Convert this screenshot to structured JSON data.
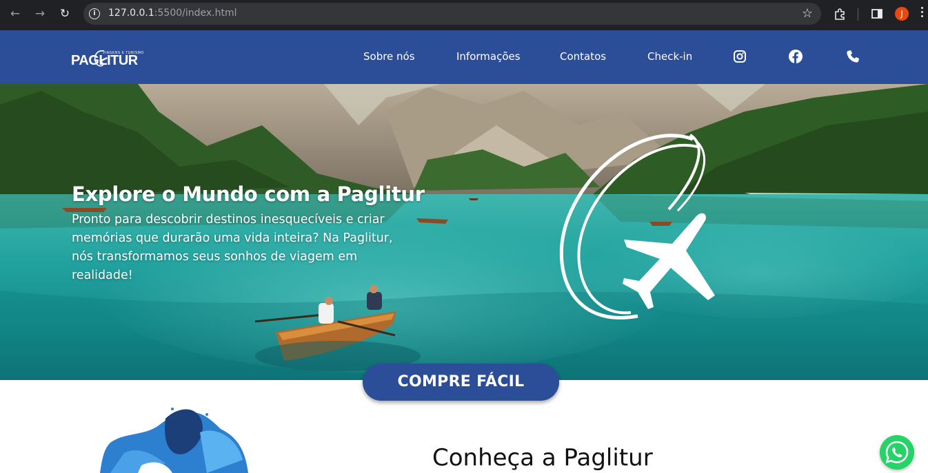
{
  "browser": {
    "url_host": "127.0.0.1",
    "url_rest": ":5500/index.html",
    "profile_initial": "J"
  },
  "header": {
    "logo_text": "PAGLITUR",
    "logo_tagline": "VIAGENS E TURISMO",
    "menu": [
      {
        "label": "Sobre nós"
      },
      {
        "label": "Informações"
      },
      {
        "label": "Contatos"
      },
      {
        "label": "Check-in"
      }
    ],
    "social_icons": [
      "instagram-icon",
      "facebook-icon",
      "phone-icon"
    ],
    "brand_color": "#2c4d97"
  },
  "hero": {
    "title": "Explore o Mundo com a Paglitur",
    "text": "Pronto para descobrir destinos inesquecíveis e criar memórias que durarão uma vida inteira? Na Paglitur, nós transformamos seus sonhos de viagem em realidade!"
  },
  "cta": {
    "label": "COMPRE FÁCIL"
  },
  "about": {
    "title": "Conheça a Paglitur"
  },
  "floating": {
    "whatsapp_icon": "whatsapp-icon"
  }
}
